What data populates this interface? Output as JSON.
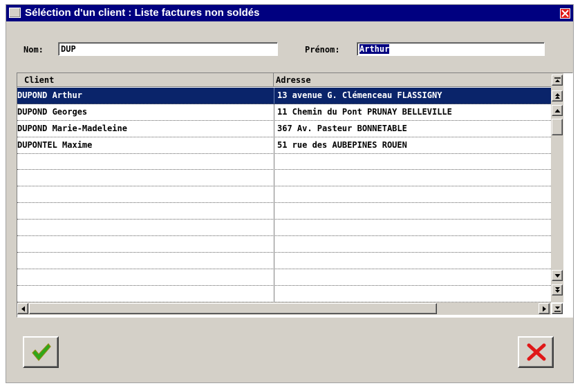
{
  "window": {
    "title": "Séléction d'un client : Liste factures non soldés",
    "close_icon": "close-icon"
  },
  "search": {
    "nom_label": "Nom:",
    "nom_value": "DUP",
    "prenom_label": "Prénom:",
    "prenom_value_prefix": "",
    "prenom_value_selected": "Arthur"
  },
  "table": {
    "columns": [
      "Client",
      "Adresse"
    ],
    "rows": [
      {
        "client": "DUPOND Arthur",
        "adresse": "13 avenue G. Clémenceau FLASSIGNY",
        "selected": true
      },
      {
        "client": "DUPOND Georges",
        "adresse": "11 Chemin du Pont PRUNAY BELLEVILLE",
        "selected": false
      },
      {
        "client": "DUPOND Marie-Madeleine",
        "adresse": "367 Av. Pasteur BONNETABLE",
        "selected": false
      },
      {
        "client": "DUPONTEL Maxime",
        "adresse": "51 rue des AUBEPINES ROUEN",
        "selected": false
      },
      {
        "client": "",
        "adresse": "",
        "selected": false
      },
      {
        "client": "",
        "adresse": "",
        "selected": false
      },
      {
        "client": "",
        "adresse": "",
        "selected": false
      },
      {
        "client": "",
        "adresse": "",
        "selected": false
      },
      {
        "client": "",
        "adresse": "",
        "selected": false
      },
      {
        "client": "",
        "adresse": "",
        "selected": false
      },
      {
        "client": "",
        "adresse": "",
        "selected": false
      },
      {
        "client": "",
        "adresse": "",
        "selected": false
      },
      {
        "client": "",
        "adresse": "",
        "selected": false
      }
    ]
  },
  "actions": {
    "confirm_icon": "checkmark-icon",
    "cancel_icon": "cross-icon"
  },
  "colors": {
    "titlebar": "#000080",
    "selection": "#0a246a",
    "confirm": "#2ea81a",
    "cancel": "#e01818"
  }
}
